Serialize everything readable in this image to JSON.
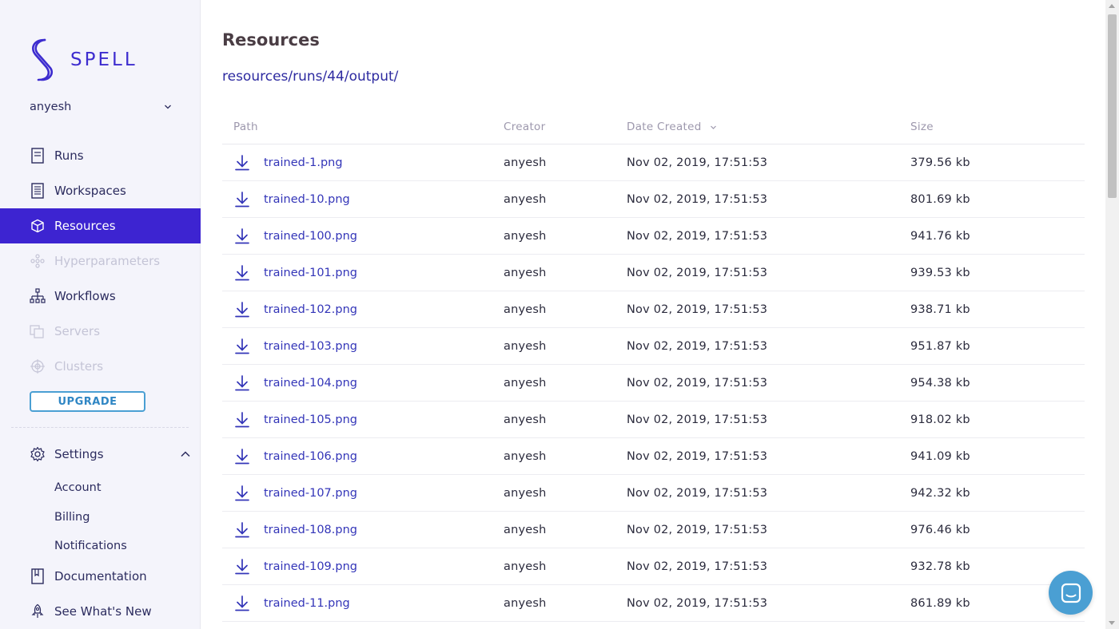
{
  "brand": {
    "name": "SPELL",
    "color": "#3d2ccf"
  },
  "user": {
    "name": "anyesh"
  },
  "nav": [
    {
      "label": "Runs",
      "icon": "document-icon",
      "state": "normal"
    },
    {
      "label": "Workspaces",
      "icon": "notebook-icon",
      "state": "normal"
    },
    {
      "label": "Resources",
      "icon": "cube-icon",
      "state": "active"
    },
    {
      "label": "Hyperparameters",
      "icon": "hyperparameters-icon",
      "state": "disabled"
    },
    {
      "label": "Workflows",
      "icon": "workflow-icon",
      "state": "normal"
    },
    {
      "label": "Servers",
      "icon": "servers-icon",
      "state": "disabled"
    },
    {
      "label": "Clusters",
      "icon": "clusters-icon",
      "state": "disabled"
    }
  ],
  "upgrade_label": "UPGRADE",
  "settings": {
    "label": "Settings",
    "sub": [
      "Account",
      "Billing",
      "Notifications"
    ]
  },
  "nav_bottom": [
    {
      "label": "Documentation",
      "icon": "book-icon"
    },
    {
      "label": "See What's New",
      "icon": "rocket-icon"
    }
  ],
  "main": {
    "title": "Resources",
    "breadcrumb": "resources/runs/44/output/"
  },
  "table": {
    "headers": {
      "path": "Path",
      "creator": "Creator",
      "date": "Date Created",
      "size": "Size"
    },
    "rows": [
      {
        "path": "trained-1.png",
        "creator": "anyesh",
        "date": "Nov 02, 2019, 17:51:53",
        "size": "379.56 kb"
      },
      {
        "path": "trained-10.png",
        "creator": "anyesh",
        "date": "Nov 02, 2019, 17:51:53",
        "size": "801.69 kb"
      },
      {
        "path": "trained-100.png",
        "creator": "anyesh",
        "date": "Nov 02, 2019, 17:51:53",
        "size": "941.76 kb"
      },
      {
        "path": "trained-101.png",
        "creator": "anyesh",
        "date": "Nov 02, 2019, 17:51:53",
        "size": "939.53 kb"
      },
      {
        "path": "trained-102.png",
        "creator": "anyesh",
        "date": "Nov 02, 2019, 17:51:53",
        "size": "938.71 kb"
      },
      {
        "path": "trained-103.png",
        "creator": "anyesh",
        "date": "Nov 02, 2019, 17:51:53",
        "size": "951.87 kb"
      },
      {
        "path": "trained-104.png",
        "creator": "anyesh",
        "date": "Nov 02, 2019, 17:51:53",
        "size": "954.38 kb"
      },
      {
        "path": "trained-105.png",
        "creator": "anyesh",
        "date": "Nov 02, 2019, 17:51:53",
        "size": "918.02 kb"
      },
      {
        "path": "trained-106.png",
        "creator": "anyesh",
        "date": "Nov 02, 2019, 17:51:53",
        "size": "941.09 kb"
      },
      {
        "path": "trained-107.png",
        "creator": "anyesh",
        "date": "Nov 02, 2019, 17:51:53",
        "size": "942.32 kb"
      },
      {
        "path": "trained-108.png",
        "creator": "anyesh",
        "date": "Nov 02, 2019, 17:51:53",
        "size": "976.46 kb"
      },
      {
        "path": "trained-109.png",
        "creator": "anyesh",
        "date": "Nov 02, 2019, 17:51:53",
        "size": "932.78 kb"
      },
      {
        "path": "trained-11.png",
        "creator": "anyesh",
        "date": "Nov 02, 2019, 17:51:53",
        "size": "861.89 kb"
      }
    ]
  },
  "colors": {
    "accent": "#3d24d1",
    "link": "#3335b8",
    "upgrade": "#4a9fd3",
    "chat": "#4a9fd3"
  }
}
